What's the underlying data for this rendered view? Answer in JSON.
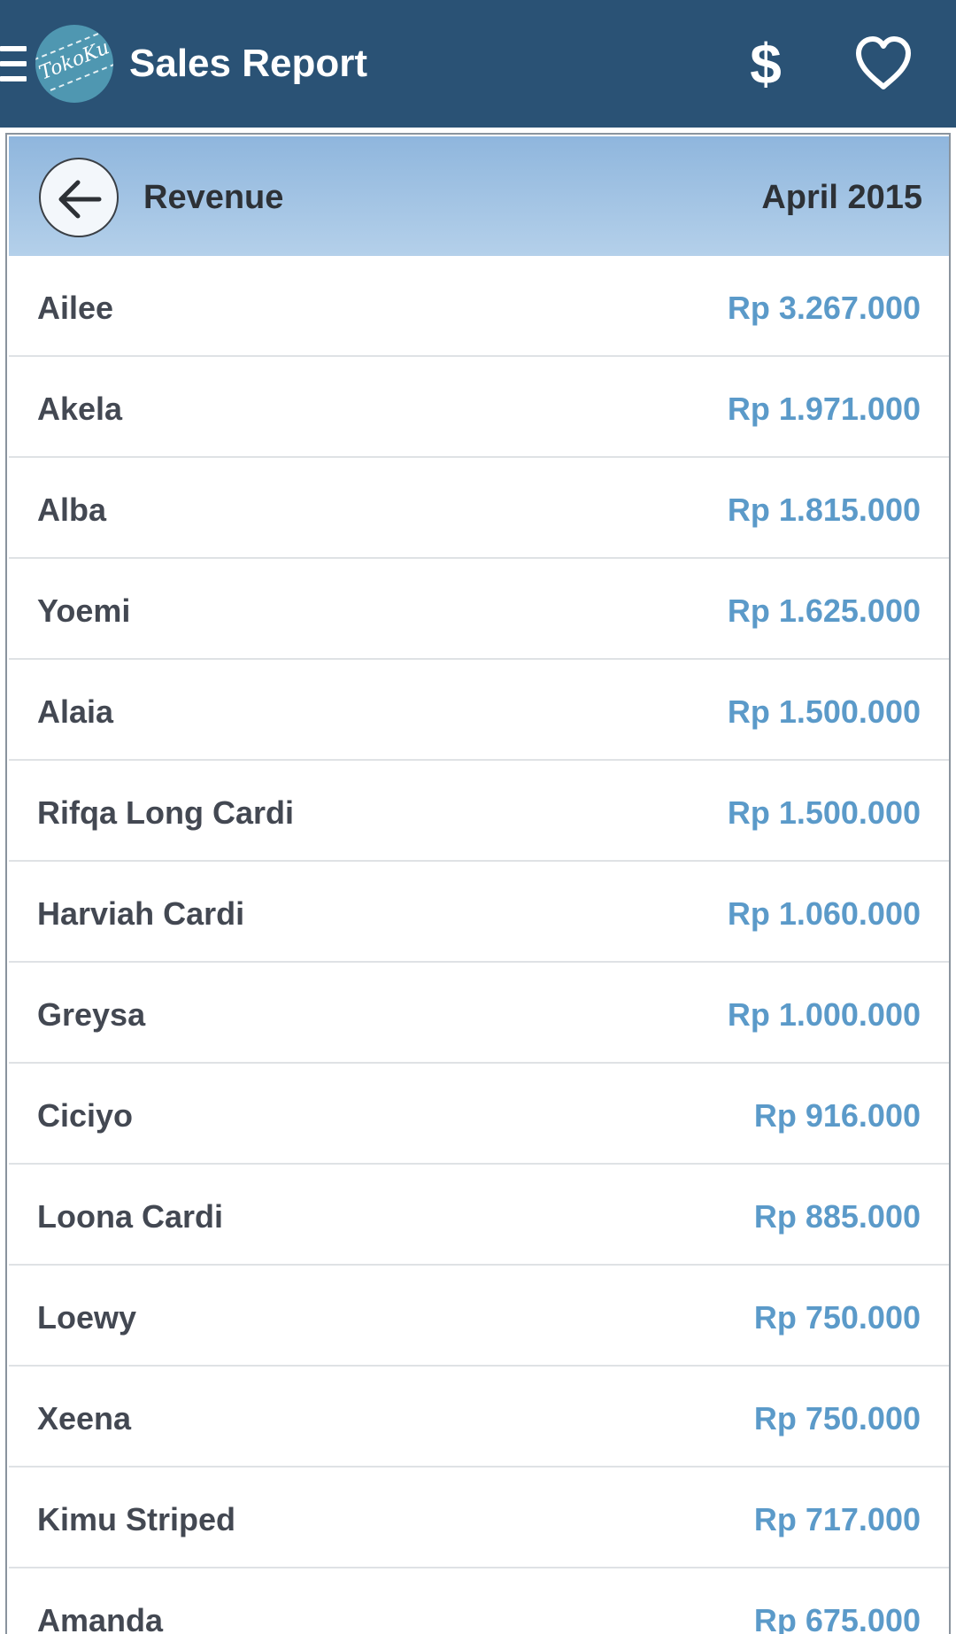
{
  "appbar": {
    "title": "Sales Report",
    "logo_text": "TokoKu",
    "menu_icon": "hamburger-menu-icon",
    "dollar_icon": "$",
    "heart_icon": "heart-outline-icon",
    "background_color": "#2a5275"
  },
  "report": {
    "title": "Revenue",
    "period": "April 2015",
    "back_icon": "arrow-left-icon",
    "amount_color": "#5b9ac9",
    "rows": [
      {
        "name": "Ailee",
        "amount": "Rp 3.267.000"
      },
      {
        "name": "Akela",
        "amount": "Rp 1.971.000"
      },
      {
        "name": "Alba",
        "amount": "Rp 1.815.000"
      },
      {
        "name": "Yoemi",
        "amount": "Rp 1.625.000"
      },
      {
        "name": "Alaia",
        "amount": "Rp 1.500.000"
      },
      {
        "name": "Rifqa Long Cardi",
        "amount": "Rp 1.500.000"
      },
      {
        "name": "Harviah Cardi",
        "amount": "Rp 1.060.000"
      },
      {
        "name": "Greysa",
        "amount": "Rp 1.000.000"
      },
      {
        "name": "Ciciyo",
        "amount": "Rp 916.000"
      },
      {
        "name": "Loona Cardi",
        "amount": "Rp 885.000"
      },
      {
        "name": "Loewy",
        "amount": "Rp 750.000"
      },
      {
        "name": "Xeena",
        "amount": "Rp 750.000"
      },
      {
        "name": "Kimu Striped",
        "amount": "Rp 717.000"
      },
      {
        "name": "Amanda",
        "amount": "Rp 675.000"
      }
    ]
  }
}
